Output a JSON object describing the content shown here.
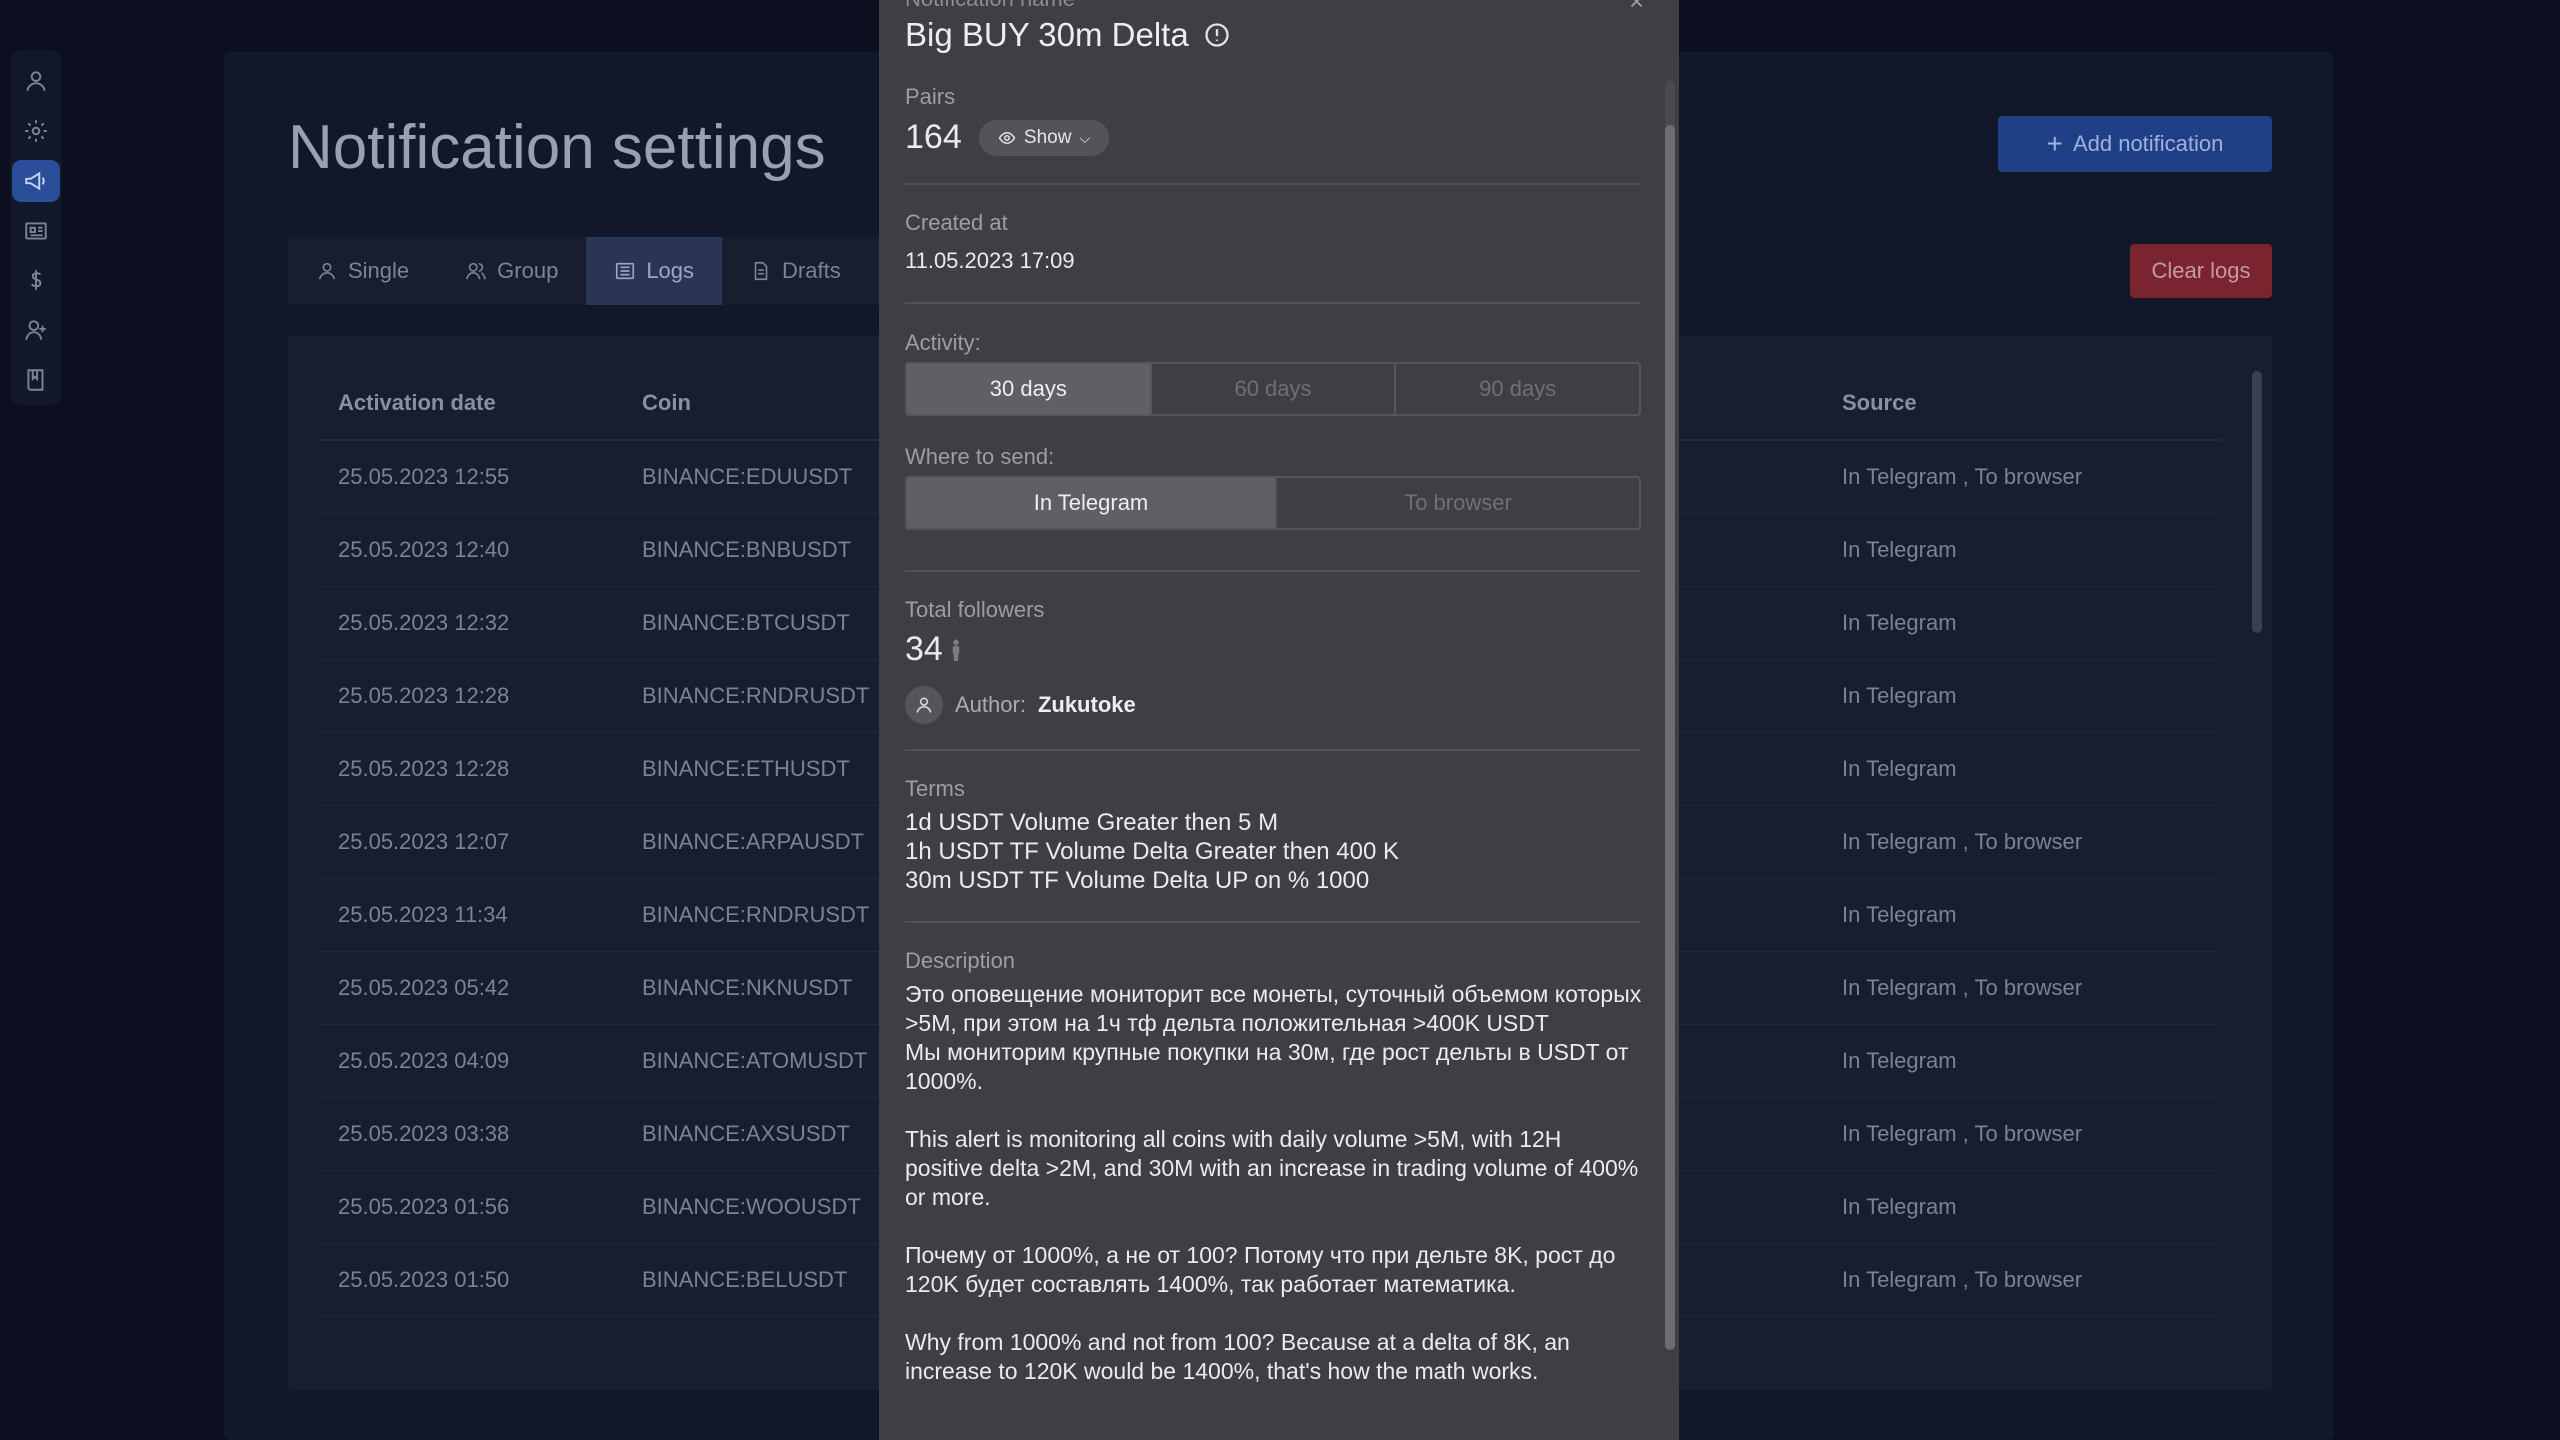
{
  "sidebar": {
    "items": [
      {
        "icon": "user-icon",
        "active": false
      },
      {
        "icon": "gear-icon",
        "active": false
      },
      {
        "icon": "megaphone-icon",
        "active": true
      },
      {
        "icon": "list-icon",
        "active": false
      },
      {
        "icon": "dollar-icon",
        "active": false
      },
      {
        "icon": "user-plus-icon",
        "active": false
      },
      {
        "icon": "book-icon",
        "active": false
      }
    ]
  },
  "page": {
    "title": "Notification settings",
    "add_label": "Add notification",
    "clear_label": "Clear logs",
    "tabs": [
      {
        "label": "Single",
        "icon": "user-icon"
      },
      {
        "label": "Group",
        "icon": "users-icon"
      },
      {
        "label": "Logs",
        "icon": "list-icon",
        "active": true
      },
      {
        "label": "Drafts",
        "icon": "file-icon"
      }
    ]
  },
  "table": {
    "headers": {
      "date": "Activation date",
      "coin": "Coin",
      "source": "Source"
    },
    "rows": [
      {
        "date": "25.05.2023 12:55",
        "coin": "BINANCE:EDUUSDT",
        "source": "In Telegram , To browser"
      },
      {
        "date": "25.05.2023 12:40",
        "coin": "BINANCE:BNBUSDT",
        "source": "In Telegram"
      },
      {
        "date": "25.05.2023 12:32",
        "coin": "BINANCE:BTCUSDT",
        "source": "In Telegram"
      },
      {
        "date": "25.05.2023 12:28",
        "coin": "BINANCE:RNDRUSDT",
        "source": "In Telegram"
      },
      {
        "date": "25.05.2023 12:28",
        "coin": "BINANCE:ETHUSDT",
        "source": "In Telegram"
      },
      {
        "date": "25.05.2023 12:07",
        "coin": "BINANCE:ARPAUSDT",
        "source": "In Telegram , To browser"
      },
      {
        "date": "25.05.2023 11:34",
        "coin": "BINANCE:RNDRUSDT",
        "source": "In Telegram"
      },
      {
        "date": "25.05.2023 05:42",
        "coin": "BINANCE:NKNUSDT",
        "source": "In Telegram , To browser"
      },
      {
        "date": "25.05.2023 04:09",
        "coin": "BINANCE:ATOMUSDT",
        "source": "In Telegram"
      },
      {
        "date": "25.05.2023 03:38",
        "coin": "BINANCE:AXSUSDT",
        "source": "In Telegram , To browser"
      },
      {
        "date": "25.05.2023 01:56",
        "coin": "BINANCE:WOOUSDT",
        "source": "In Telegram"
      },
      {
        "date": "25.05.2023 01:50",
        "coin": "BINANCE:BELUSDT",
        "source": "In Telegram , To browser"
      }
    ]
  },
  "modal": {
    "name_label": "Notification name",
    "close_glyph": "×",
    "title": "Big BUY 30m Delta",
    "pairs_label": "Pairs",
    "pairs_value": "164",
    "show_label": "Show",
    "created_label": "Created at",
    "created_value": "11.05.2023 17:09",
    "activity_label": "Activity:",
    "activity_options": [
      "30 days",
      "60 days",
      "90 days"
    ],
    "activity_selected": "30 days",
    "send_label": "Where to send:",
    "send_options": [
      "In Telegram",
      "To browser"
    ],
    "send_selected": "In Telegram",
    "followers_label": "Total followers",
    "followers_value": "34",
    "author_label": "Author:",
    "author_name": "Zukutoke",
    "terms_label": "Terms",
    "terms": [
      "1d USDT Volume Greater then 5 M",
      "1h USDT TF Volume Delta Greater then 400 K",
      "30m USDT TF Volume Delta UP on % 1000"
    ],
    "description_label": "Description",
    "description": [
      "Это оповещение мониторит все монеты, суточный объемом которых >5M, при этом на 1ч тф дельта положительная >400K USDT\nМы мониторим крупные покупки на 30м, где рост дельты в USDT от 1000%.",
      "This alert is monitoring all coins with daily volume >5M, with 12H positive delta >2M, and 30M with an increase in trading volume of 400% or more.",
      "Почему от 1000%, а не от 100? Потому что при дельте 8K, рост до 120K будет составлять 1400%, так работает математика.",
      "Why from 1000% and not from 100? Because at a delta of 8K, an increase to 120K would be 1400%, that's how the math works."
    ]
  }
}
